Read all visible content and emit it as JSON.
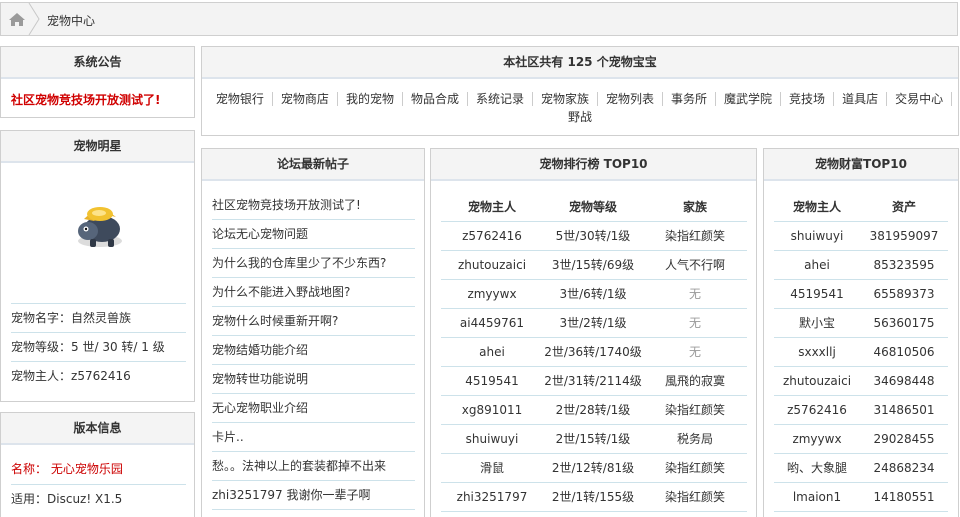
{
  "breadcrumb": {
    "current": "宠物中心"
  },
  "notice_panel": {
    "title": "系统公告",
    "text": "社区宠物竞技场开放测试了!"
  },
  "star_panel": {
    "title": "宠物明星",
    "rows": [
      {
        "label": "宠物名字：",
        "value": "自然灵兽族"
      },
      {
        "label": "宠物等级：",
        "value": "5 世/ 30 转/ 1 级"
      },
      {
        "label": "宠物主人：",
        "value": "z5762416"
      }
    ]
  },
  "version_panel": {
    "title": "版本信息",
    "name_label": "名称：",
    "name_value": "无心宠物乐园",
    "apply_label": "适用：",
    "apply_value": "Discuz! X1.5"
  },
  "summary_panel": {
    "title_prefix": "本社区共有",
    "count": "125",
    "title_suffix": "个宠物宝宝",
    "menu": [
      "宠物银行",
      "宠物商店",
      "我的宠物",
      "物品合成",
      "系统记录",
      "宠物家族",
      "宠物列表",
      "事务所",
      "魔武学院",
      "竞技场",
      "道具店",
      "交易中心",
      "野战"
    ]
  },
  "forum_panel": {
    "title": "论坛最新帖子",
    "posts": [
      "社区宠物竞技场开放测试了!",
      "论坛无心宠物问题",
      "为什么我的仓库里少了不少东西?",
      "为什么不能进入野战地图?",
      "宠物什么时候重新开啊?",
      "宠物结婚功能介绍",
      "宠物转世功能说明",
      "无心宠物职业介绍",
      "卡片..",
      "愁。。法神以上的套装都掉不出来",
      "zhi3251797 我谢你一辈子啊"
    ]
  },
  "rank_panel": {
    "title": "宠物排行榜 TOP10",
    "headers": [
      "宠物主人",
      "宠物等级",
      "家族"
    ],
    "rows": [
      [
        "z5762416",
        "5世/30转/1级",
        "染指红颜笑"
      ],
      [
        "zhutouzaici",
        "3世/15转/69级",
        "人气不行啊"
      ],
      [
        "zmyywx",
        "3世/6转/1级",
        "无"
      ],
      [
        "ai4459761",
        "3世/2转/1级",
        "无"
      ],
      [
        "ahei",
        "2世/36转/1740级",
        "无"
      ],
      [
        "4519541",
        "2世/31转/2114级",
        "風飛的寂寞"
      ],
      [
        "xg891011",
        "2世/28转/1级",
        "染指红颜笑"
      ],
      [
        "shuiwuyi",
        "2世/15转/1级",
        "税务局"
      ],
      [
        "滑鼠",
        "2世/12转/81级",
        "染指红颜笑"
      ],
      [
        "zhi3251797",
        "2世/1转/155级",
        "染指红颜笑"
      ]
    ]
  },
  "wealth_panel": {
    "title": "宠物财富TOP10",
    "headers": [
      "宠物主人",
      "资产"
    ],
    "rows": [
      [
        "shuiwuyi",
        "381959097"
      ],
      [
        "ahei",
        "85323595"
      ],
      [
        "4519541",
        "65589373"
      ],
      [
        "默小宝",
        "56360175"
      ],
      [
        "sxxxllj",
        "46810506"
      ],
      [
        "zhutouzaici",
        "34698448"
      ],
      [
        "z5762416",
        "31486501"
      ],
      [
        "zmyywx",
        "29028455"
      ],
      [
        "哟、大象腿",
        "24868234"
      ],
      [
        "lmaion1",
        "14180551"
      ]
    ]
  }
}
